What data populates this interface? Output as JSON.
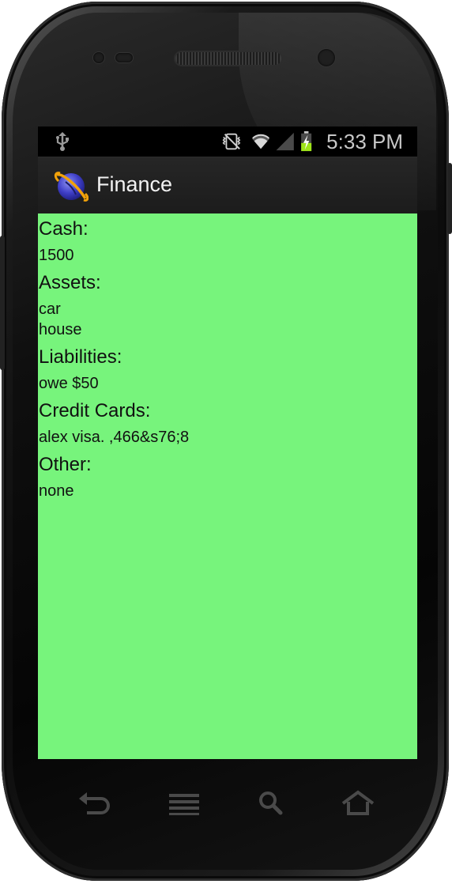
{
  "app": {
    "title": "Finance",
    "icon": "finance-planet-icon"
  },
  "status_bar": {
    "time": "5:33 PM",
    "icons": [
      "usb-icon",
      "vibrate-icon",
      "wifi-icon",
      "signal-icon",
      "battery-charging-icon"
    ]
  },
  "sections": [
    {
      "heading": "Cash:",
      "values": [
        "1500"
      ]
    },
    {
      "heading": "Assets:",
      "values": [
        "car",
        "house"
      ]
    },
    {
      "heading": "Liabilities:",
      "values": [
        "owe $50"
      ]
    },
    {
      "heading": "Credit Cards:",
      "values": [
        "alex visa. ,466&s76;8"
      ]
    },
    {
      "heading": "Other:",
      "values": [
        "none"
      ]
    }
  ],
  "nav_buttons": [
    "back-icon",
    "menu-icon",
    "search-icon",
    "home-icon"
  ],
  "colors": {
    "content_bg": "#77f47c",
    "status_bar": "#000000",
    "action_bar": "#212121"
  }
}
